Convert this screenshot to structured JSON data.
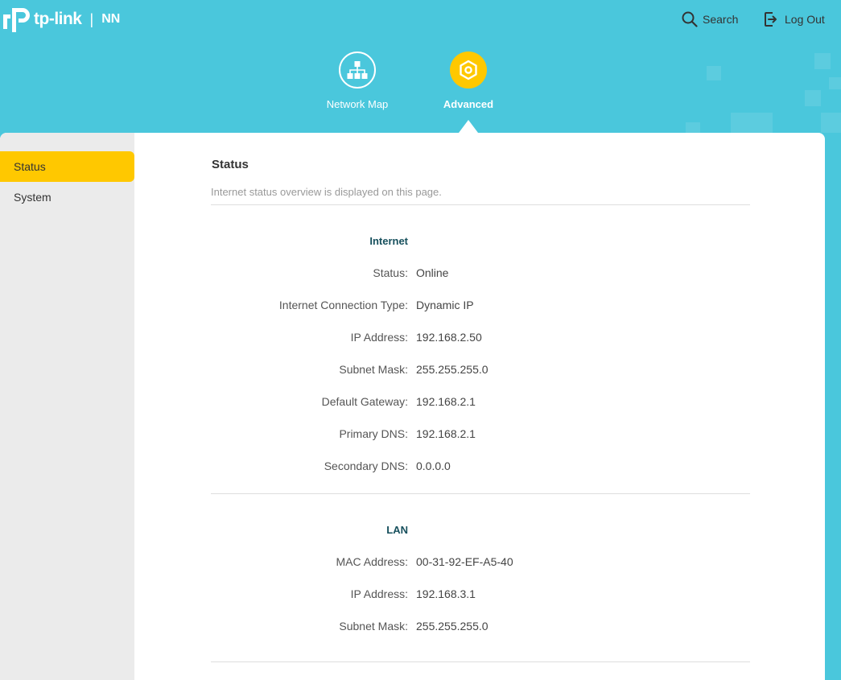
{
  "header": {
    "brand": "tp-link",
    "separator": "|",
    "model": "NN",
    "search_label": "Search",
    "logout_label": "Log Out",
    "accent_color": "#4ac7dc",
    "active_color": "#ffc800"
  },
  "nav": {
    "network_map": {
      "label": "Network Map",
      "icon": "network-map-icon"
    },
    "advanced": {
      "label": "Advanced",
      "icon": "advanced-gear-icon"
    }
  },
  "sidebar": {
    "items": [
      {
        "label": "Status",
        "active": true
      },
      {
        "label": "System",
        "active": false
      }
    ]
  },
  "main": {
    "title": "Status",
    "description": "Internet status overview is displayed on this page.",
    "internet": {
      "title": "Internet",
      "rows": [
        {
          "label": "Status:",
          "value": "Online"
        },
        {
          "label": "Internet Connection Type:",
          "value": "Dynamic IP"
        },
        {
          "label": "IP Address:",
          "value": "192.168.2.50"
        },
        {
          "label": "Subnet Mask:",
          "value": "255.255.255.0"
        },
        {
          "label": "Default Gateway:",
          "value": "192.168.2.1"
        },
        {
          "label": "Primary DNS:",
          "value": "192.168.2.1"
        },
        {
          "label": "Secondary DNS:",
          "value": "0.0.0.0"
        }
      ]
    },
    "lan": {
      "title": "LAN",
      "rows": [
        {
          "label": "MAC Address:",
          "value": "00-31-92-EF-A5-40"
        },
        {
          "label": "IP Address:",
          "value": "192.168.3.1"
        },
        {
          "label": "Subnet Mask:",
          "value": "255.255.255.0"
        }
      ]
    }
  }
}
